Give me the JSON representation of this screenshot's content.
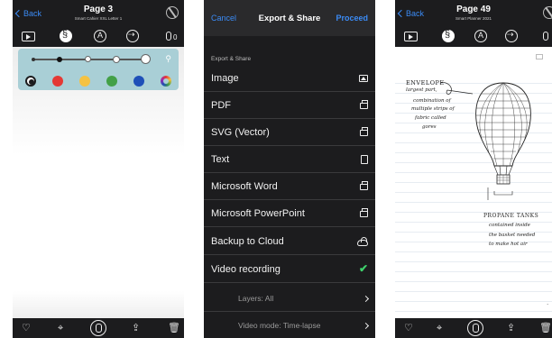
{
  "screen1": {
    "nav": {
      "back_label": "Back",
      "title": "Page 3",
      "subtitle": "Smart Cahier XXL Letter 1"
    },
    "toolbar": {
      "mic_count": "0"
    },
    "pen_size_slider": {
      "selected_index": 1,
      "stops": 5
    },
    "colors": [
      "#1c1c1e",
      "#e53935",
      "#f5c242",
      "#43a047",
      "#1e4fb8",
      "rainbow"
    ],
    "selected_color_index": 0,
    "accent": "#3b8bf5"
  },
  "screen2": {
    "nav": {
      "cancel_label": "Cancel",
      "title": "Export & Share",
      "proceed_label": "Proceed"
    },
    "section_header": "Export & Share",
    "rows": [
      {
        "label": "Image",
        "icon": "image-icon"
      },
      {
        "label": "PDF",
        "icon": "printer-icon"
      },
      {
        "label": "SVG (Vector)",
        "icon": "printer-icon"
      },
      {
        "label": "Text",
        "icon": "document-icon"
      },
      {
        "label": "Microsoft Word",
        "icon": "printer-icon"
      },
      {
        "label": "Microsoft PowerPoint",
        "icon": "printer-icon"
      },
      {
        "label": "Backup to Cloud",
        "icon": "cloud-upload-icon"
      },
      {
        "label": "Video recording",
        "icon": "checkmark-icon"
      }
    ],
    "sub_rows": [
      {
        "label": "Layers: All",
        "icon": "chevron-right-icon"
      },
      {
        "label": "Video mode: Time-lapse",
        "icon": "chevron-right-icon"
      }
    ],
    "check_color": "#3fd16c"
  },
  "screen3": {
    "nav": {
      "back_label": "Back",
      "title": "Page 49",
      "subtitle": "Smart Planner 2021"
    },
    "handwriting": {
      "envelope_title": "ENVELOPE",
      "envelope_lines": [
        "largest part,",
        "combination of",
        "multiple strips of",
        "fabric called",
        "gores"
      ],
      "propane_title": "PROPANE TANKS",
      "propane_lines": [
        "contained inside",
        "the basket needed",
        "to make hot air"
      ]
    },
    "page_marker": "-"
  }
}
